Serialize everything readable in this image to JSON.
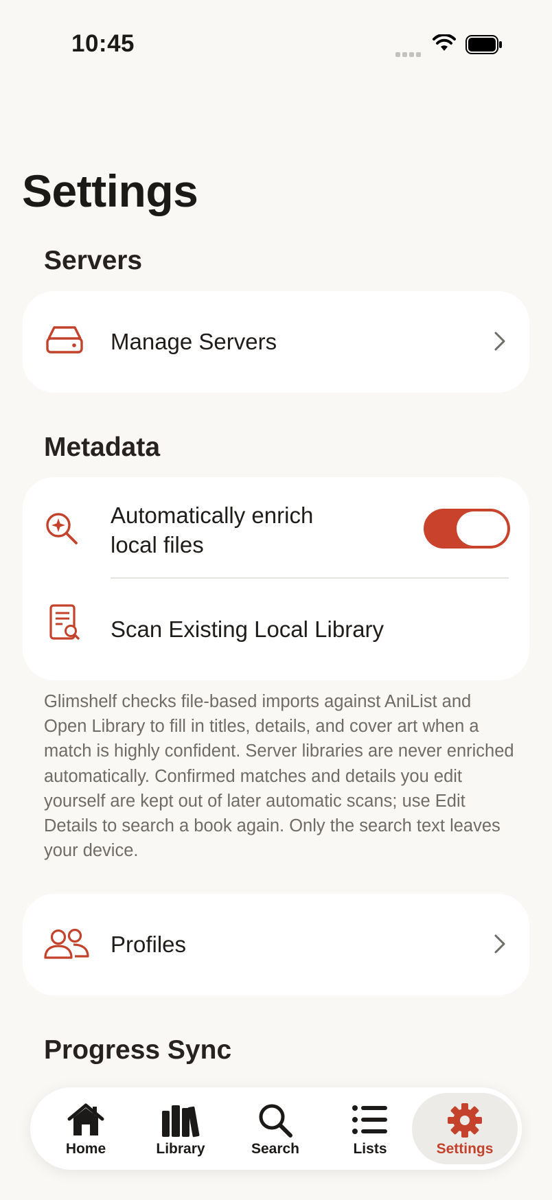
{
  "status_bar": {
    "time": "10:45"
  },
  "page": {
    "title": "Settings"
  },
  "sections": {
    "servers": {
      "title": "Servers",
      "manage_servers": {
        "label": "Manage Servers",
        "icon": "server-drive-icon"
      }
    },
    "metadata": {
      "title": "Metadata",
      "auto_enrich": {
        "label_line1": "Automatically enrich",
        "label_line2": "local files",
        "icon": "magnify-sparkle-icon",
        "enabled": true
      },
      "scan_library": {
        "label": "Scan Existing Local Library",
        "icon": "document-search-icon"
      },
      "footnote": "Glimshelf checks file-based imports against AniList and Open Library to fill in titles, details, and cover art when a match is highly confident. Server libraries are never enriched automatically. Confirmed matches and details you edit yourself are kept out of later automatic scans; use Edit Details to search a book again. Only the search text leaves your device."
    },
    "profiles": {
      "label": "Profiles",
      "icon": "people-icon"
    },
    "progress_sync": {
      "title": "Progress Sync"
    }
  },
  "tab_bar": {
    "items": [
      {
        "label": "Home",
        "icon": "house-icon"
      },
      {
        "label": "Library",
        "icon": "books-icon"
      },
      {
        "label": "Search",
        "icon": "search-icon"
      },
      {
        "label": "Lists",
        "icon": "list-icon"
      },
      {
        "label": "Settings",
        "icon": "gear-icon",
        "active": true
      }
    ]
  },
  "colors": {
    "accent": "#c9432c",
    "background": "#f9f8f5",
    "card": "#ffffff",
    "secondary_text": "#6f6b66"
  }
}
